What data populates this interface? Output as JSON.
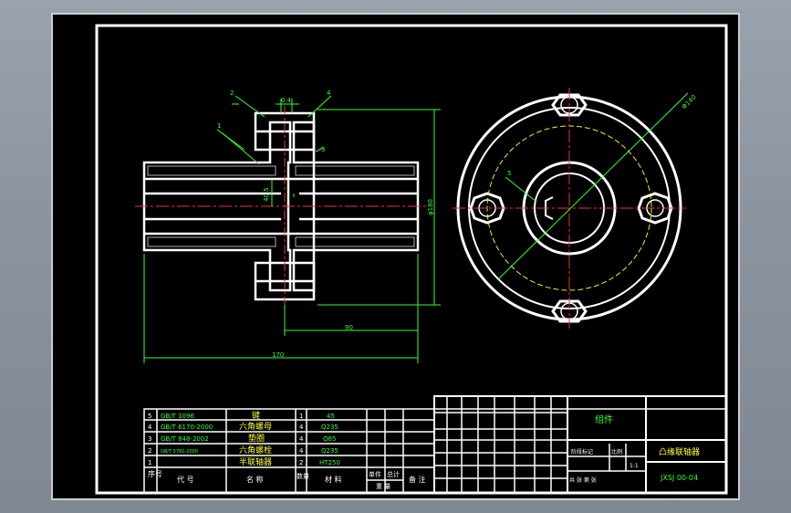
{
  "drawing": {
    "dimensions": {
      "flange_gap": "0.4",
      "outer_diameter": "φ180",
      "shaft_height": "40.5",
      "shaft_length": "90",
      "overall_length": "170",
      "bolt_circle": "Φ140"
    },
    "balloons": [
      "1",
      "2",
      "3",
      "4",
      "5"
    ]
  },
  "title_block": {
    "drawing_name": "凸缘联轴器",
    "drawing_number": "JXSJ 00-04",
    "assembly_label": "组件",
    "stage_label": "阶段标记",
    "scale_label": "比例",
    "scale_value": "1:1",
    "sheet_label": "共 张 第 张"
  },
  "bom": {
    "headers": {
      "seq": "序号",
      "code": "代 号",
      "name": "名 称",
      "qty": "数量",
      "material": "材 料",
      "unit_weight": "单件",
      "total_weight": "总计",
      "weight": "重 量",
      "remarks": "备 注"
    },
    "rows": [
      {
        "seq": "5",
        "code": "GB/T 1096",
        "name": "键",
        "qty": "1",
        "material": "45"
      },
      {
        "seq": "4",
        "code": "GB/T 6170-2000",
        "name": "六角螺母",
        "qty": "4",
        "material": "Q235"
      },
      {
        "seq": "3",
        "code": "GB/T 848-2002",
        "name": "垫圈",
        "qty": "4",
        "material": "Q65"
      },
      {
        "seq": "2",
        "code": "GB/T 5782-2000",
        "name": "六角螺栓",
        "qty": "4",
        "material": "Q235"
      },
      {
        "seq": "1",
        "code": "",
        "name": "半联轴器",
        "qty": "2",
        "material": "HT250"
      }
    ]
  }
}
